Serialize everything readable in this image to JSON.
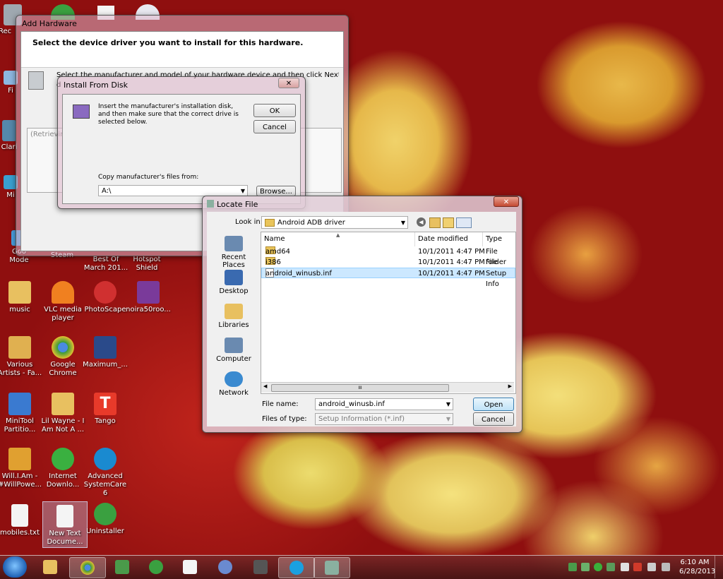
{
  "desktop": {
    "icons": [
      {
        "label": "Rec",
        "color": "#9fa8b0"
      },
      {
        "label": "Fi",
        "color": "#8db7e0"
      },
      {
        "label": "Clari",
        "color": "#5588aa"
      },
      {
        "label": "Mi",
        "color": "#3aa0d0"
      },
      {
        "label": "Goo Mode",
        "color": "#4aa0e0"
      },
      {
        "label": "Steam",
        "color": "#555a60"
      },
      {
        "label": "Best Of March 201...",
        "color": "#b0b0b0"
      },
      {
        "label": "Hotspot Shield",
        "color": "#4a8a40"
      },
      {
        "label": "music",
        "color": "#e8c060"
      },
      {
        "label": "VLC media player",
        "color": "#f08020"
      },
      {
        "label": "PhotoScape",
        "color": "#d03030"
      },
      {
        "label": "noira50roo...",
        "color": "#7a3a9a"
      },
      {
        "label": "Various Artists - Fa...",
        "color": "#e0b050"
      },
      {
        "label": "Google Chrome",
        "color": "#3a9a3a"
      },
      {
        "label": "Maximum_...",
        "color": "#2a4a8a"
      },
      {
        "label": "MiniTool Partitio...",
        "color": "#3a7ad0"
      },
      {
        "label": "Lil Wayne - I Am Not A ...",
        "color": "#e8c060"
      },
      {
        "label": "Tango",
        "color": "#e83a2a"
      },
      {
        "label": "Will.I.Am - #WillPowe...",
        "color": "#e0a030"
      },
      {
        "label": "Internet Downlo...",
        "color": "#3ab040"
      },
      {
        "label": "Advanced SystemCare 6",
        "color": "#1a8ad0"
      },
      {
        "label": "mobiles.txt",
        "color": "#f4f4f4"
      },
      {
        "label": "New Text Docume...",
        "color": "#f4f4f4"
      },
      {
        "label": "Uninstaller",
        "color": "#3aa040"
      }
    ]
  },
  "add_hardware": {
    "title": "Add Hardware",
    "heading": "Select the device driver you want to install for this hardware.",
    "description": "Select the manufacturer and model of your hardware device and then click Next. If you have a",
    "description_clip": "d",
    "list_text": "(Retrievin"
  },
  "install_from_disk": {
    "title": "Install From Disk",
    "close": "✕",
    "message": "Insert the manufacturer's installation disk, and then make sure that the correct drive is selected below.",
    "ok_label": "OK",
    "cancel_label": "Cancel",
    "copy_label": "Copy manufacturer's files from:",
    "copy_value": "A:\\",
    "browse_label": "Browse..."
  },
  "locate_file": {
    "title": "Locate File",
    "close": "✕",
    "look_in_label": "Look in:",
    "look_in_value": "Android ADB driver",
    "places": [
      {
        "label": "Recent Places",
        "color": "#6a8ab0"
      },
      {
        "label": "Desktop",
        "color": "#3a6ab0"
      },
      {
        "label": "Libraries",
        "color": "#e8c060"
      },
      {
        "label": "Computer",
        "color": "#6a8ab0"
      },
      {
        "label": "Network",
        "color": "#3a8ad0"
      }
    ],
    "columns": [
      "Name",
      "Date modified",
      "Type"
    ],
    "files": [
      {
        "name": "amd64",
        "date": "10/1/2011 4:47 PM",
        "type": "File folder",
        "kind": "folder"
      },
      {
        "name": "i386",
        "date": "10/1/2011 4:47 PM",
        "type": "File folder",
        "kind": "folder"
      },
      {
        "name": "android_winusb.inf",
        "date": "10/1/2011 4:47 PM",
        "type": "Setup Info",
        "kind": "file"
      }
    ],
    "filename_label": "File name:",
    "filename_value": "android_winusb.inf",
    "filetype_label": "Files of type:",
    "filetype_value": "Setup Information (*.inf)",
    "open_label": "Open",
    "cancel_label": "Cancel",
    "scroll_marker": "III"
  },
  "taskbar": {
    "buttons": [
      {
        "name": "explorer",
        "color": "#e8c060"
      },
      {
        "name": "chrome",
        "color": "#3a9a3a"
      },
      {
        "name": "device-manager",
        "color": "#4a9a4a"
      },
      {
        "name": "utorrent",
        "color": "#3aa040"
      },
      {
        "name": "notepad",
        "color": "#f4f4f4"
      },
      {
        "name": "media-center",
        "color": "#6a8ad0"
      },
      {
        "name": "game",
        "color": "#555555"
      },
      {
        "name": "skype",
        "color": "#1aa0e0"
      },
      {
        "name": "add-hardware",
        "color": "#8ab0a0"
      }
    ],
    "time": "6:10 AM",
    "date": "6/28/2013"
  }
}
